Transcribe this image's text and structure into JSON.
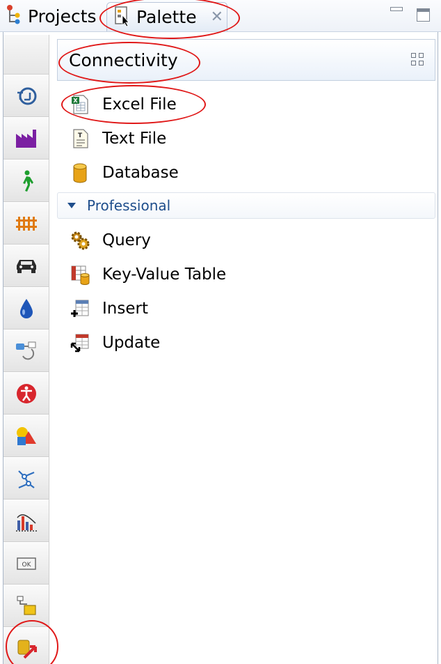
{
  "tabs": {
    "projects_label": "Projects",
    "palette_label": "Palette",
    "close_glyph": "✕"
  },
  "palette": {
    "drawer_title": "Connectivity",
    "items": [
      {
        "label": "Excel File",
        "icon": "excel-file-icon"
      },
      {
        "label": "Text File",
        "icon": "text-file-icon"
      },
      {
        "label": "Database",
        "icon": "database-icon"
      }
    ],
    "section": {
      "label": "Professional",
      "expanded": true,
      "items": [
        {
          "label": "Query",
          "icon": "query-icon"
        },
        {
          "label": "Key-Value Table",
          "icon": "key-value-table-icon"
        },
        {
          "label": "Insert",
          "icon": "insert-icon"
        },
        {
          "label": "Update",
          "icon": "update-icon"
        }
      ]
    }
  },
  "side_strip": {
    "buttons": [
      "process-modeling-icon",
      "factory-icon",
      "pedestrian-icon",
      "rail-icon",
      "car-icon",
      "fluid-drop-icon",
      "agent-flow-icon",
      "accessibility-icon",
      "shapes-icon",
      "network-icon",
      "analysis-chart-icon",
      "ok-button-control-icon",
      "connectivity-small-icon",
      "connectivity-active-icon"
    ]
  },
  "colors": {
    "annotation_red": "#e01818",
    "section_blue": "#1f4e8c",
    "header_border": "#c3cfdf"
  }
}
